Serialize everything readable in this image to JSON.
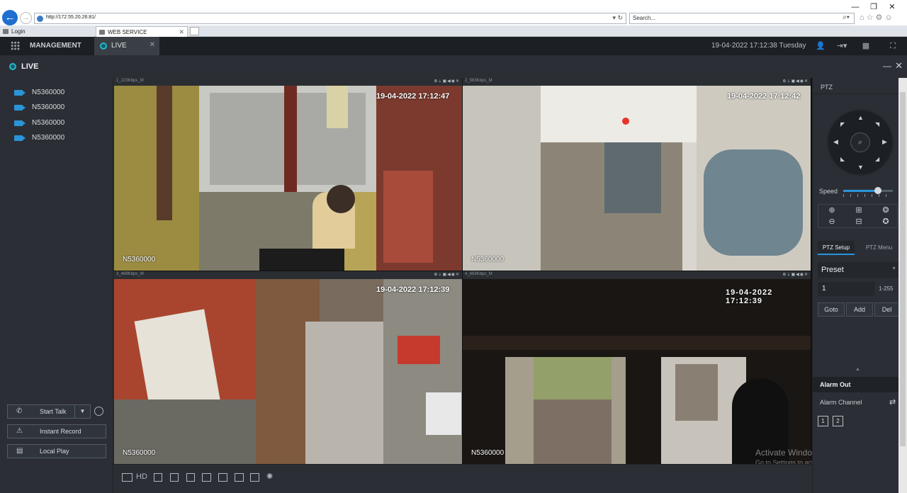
{
  "browser": {
    "url": "http://172.55.20.26:81/",
    "search_placeholder": "Search...",
    "tabs": [
      {
        "label": "Login"
      },
      {
        "label": "WEB SERVICE"
      }
    ],
    "window_controls": {
      "minimize": "—",
      "restore": "❐",
      "close": "✕"
    }
  },
  "app": {
    "menu_label": "MANAGEMENT",
    "active_tab": "LIVE",
    "datetime": "19-04-2022 17:12:38 Tuesday",
    "header_title": "LIVE"
  },
  "channels": [
    {
      "name": "N5360000"
    },
    {
      "name": "N5360000"
    },
    {
      "name": "N5360000"
    },
    {
      "name": "N5360000"
    }
  ],
  "left_buttons": {
    "talk": "Start Talk",
    "record": "Instant Record",
    "local_play": "Local Play"
  },
  "cells": [
    {
      "bar": "1_223Kbps_M",
      "osd_time": "19-04-2022 17:12:47",
      "osd_name": "N5360000"
    },
    {
      "bar": "2_563Kbps_M",
      "osd_time": "19-04-2022 17:12:42",
      "osd_name": "N5360000"
    },
    {
      "bar": "3_469Kbps_M",
      "osd_time": "19-04-2022 17:12:39",
      "osd_name": "N5360000"
    },
    {
      "bar": "4_693Kbps_M",
      "osd_time": "19-04-2022  17:12:39",
      "osd_name": "N5360000"
    }
  ],
  "toolbar": {
    "hd": "HD"
  },
  "watermark": {
    "line1": "Activate Windows",
    "line2": "Go to Settings to activate Windows."
  },
  "ptz": {
    "title": "PTZ",
    "speed_label": "Speed",
    "speed_value": 0.7,
    "tabs": [
      "PTZ Setup",
      "PTZ Menu"
    ],
    "preset_label": "Preset",
    "preset_value": "1",
    "preset_range": "1-255",
    "buttons": [
      "Goto",
      "Add",
      "Del"
    ],
    "alarm_title": "Alarm Out",
    "alarm_channel_label": "Alarm Channel",
    "alarm_buttons": [
      "1",
      "2"
    ]
  },
  "colors": {
    "accent": "#2a94d8",
    "active_cell": "#3fb54a",
    "live_dot": "#27b7c9"
  }
}
